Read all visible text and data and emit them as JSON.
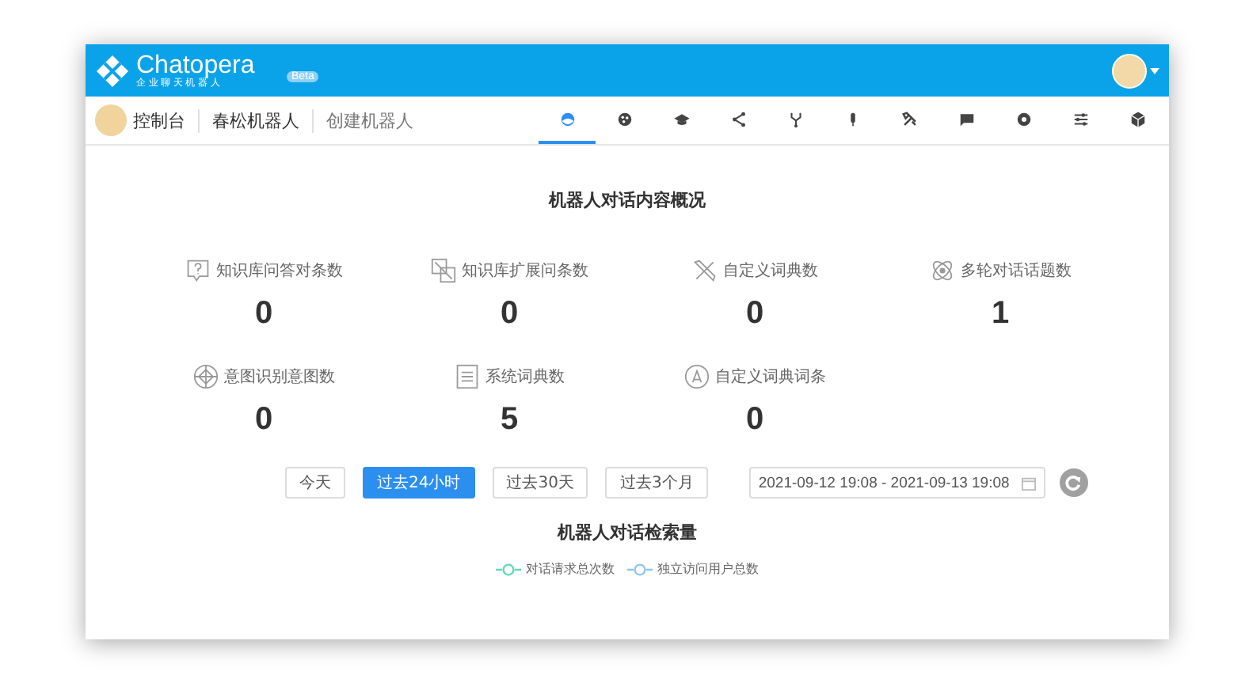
{
  "header": {
    "logo_name": "Chatopera",
    "logo_tagline": "企业聊天机器人",
    "badge": "Beta"
  },
  "breadcrumb": [
    "控制台",
    "春松机器人",
    "创建机器人"
  ],
  "tabs": [
    {
      "selected": true
    },
    {
      "selected": false
    },
    {
      "selected": false
    },
    {
      "selected": false
    },
    {
      "selected": false
    },
    {
      "selected": false
    },
    {
      "selected": false
    },
    {
      "selected": false
    },
    {
      "selected": false
    },
    {
      "selected": false
    },
    {
      "selected": false
    }
  ],
  "overview": {
    "title": "机器人对话内容概况",
    "stats": [
      {
        "label": "知识库问答对条数",
        "value": "0"
      },
      {
        "label": "知识库扩展问条数",
        "value": "0"
      },
      {
        "label": "自定义词典数",
        "value": "0"
      },
      {
        "label": "多轮对话话题数",
        "value": "1"
      },
      {
        "label": "意图识别意图数",
        "value": "0"
      },
      {
        "label": "系统词典数",
        "value": "5"
      },
      {
        "label": "自定义词典词条",
        "value": "0"
      }
    ]
  },
  "ranges": [
    {
      "label": "今天",
      "selected": false
    },
    {
      "label": "过去24小时",
      "selected": true
    },
    {
      "label": "过去30天",
      "selected": false
    },
    {
      "label": "过去3个月",
      "selected": false
    }
  ],
  "date_range": {
    "value": "2021-09-12 19:08 - 2021-09-13 19:08"
  },
  "volume": {
    "title": "机器人对话检索量",
    "legend": [
      {
        "name": "对话请求总次数",
        "color": "#5fd9b5"
      },
      {
        "name": "独立访问用户总数",
        "color": "#8ec5f0"
      }
    ]
  }
}
